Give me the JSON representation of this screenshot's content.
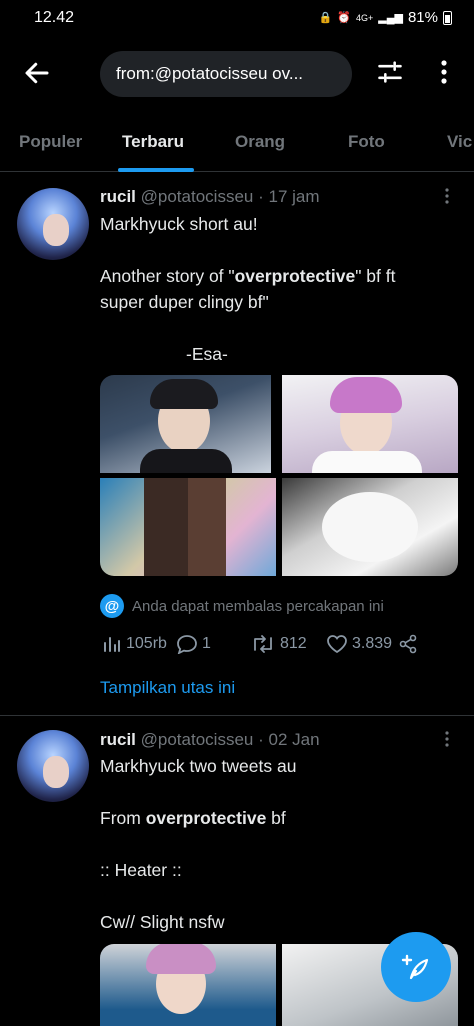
{
  "status": {
    "time": "12.42",
    "network": "4G+",
    "battery": "81%"
  },
  "search": {
    "query": "from:@potatocisseu ov..."
  },
  "tabs": [
    {
      "label": "Populer"
    },
    {
      "label": "Terbaru"
    },
    {
      "label": "Orang"
    },
    {
      "label": "Foto"
    },
    {
      "label": "Vic"
    }
  ],
  "tweets": [
    {
      "name": "rucil",
      "handle": "@potatocisseu",
      "time": "17 jam",
      "line1": "Markhyuck short au!",
      "line2_pre": "Another story of \"",
      "line2_bold": "overprotective",
      "line2_post": "\" bf ft",
      "line3": "super duper clingy bf\"",
      "line4": "-Esa-",
      "reply_note": "Anda dapat membalas percakapan ini",
      "views": "105rb",
      "replies": "1",
      "retweets": "812",
      "likes": "3.839",
      "show_thread": "Tampilkan utas ini"
    },
    {
      "name": "rucil",
      "handle": "@potatocisseu",
      "time": "02 Jan",
      "line1": "Markhyuck two tweets au",
      "line2_pre": "From ",
      "line2_bold": "overprotective",
      "line2_post": " bf",
      "line3": ":: Heater ::",
      "line4": "Cw// Slight nsfw"
    }
  ],
  "icons": {
    "back": "arrow-left-icon",
    "filter": "sliders-icon",
    "more": "more-vertical-icon",
    "compose": "compose-feather-icon"
  },
  "colors": {
    "accent": "#1d9bf0",
    "background": "#000000",
    "muted": "#71767b"
  }
}
